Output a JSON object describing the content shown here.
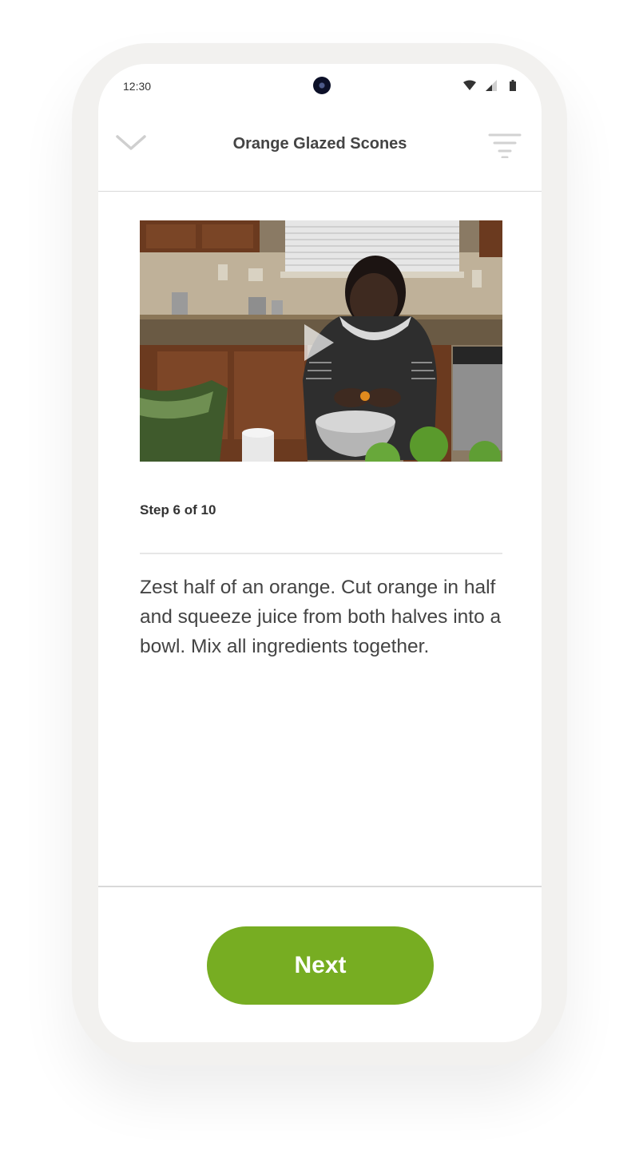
{
  "status_bar": {
    "time": "12:30"
  },
  "header": {
    "title": "Orange Glazed Scones",
    "back_icon": "chevron-down-icon",
    "filter_icon": "filter-icon"
  },
  "video": {
    "play_icon": "play-icon"
  },
  "step": {
    "label": "Step 6 of 10",
    "current": 6,
    "total": 10,
    "instruction": "Zest half of an orange.  Cut orange in half and squeeze juice from both halves into a bowl. Mix all ingredients together."
  },
  "footer": {
    "next_label": "Next"
  },
  "colors": {
    "accent": "#77ad22",
    "title_text": "#444444",
    "divider": "#d9d9d9"
  }
}
